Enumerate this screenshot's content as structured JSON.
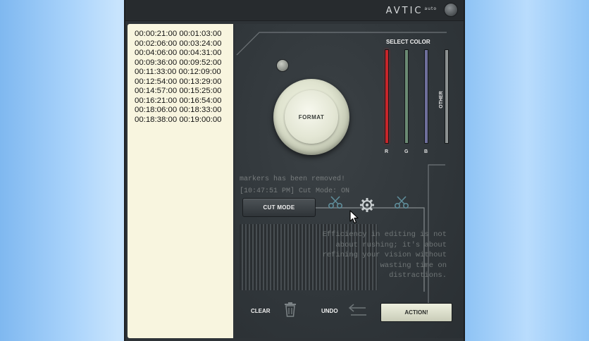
{
  "app": {
    "brand": "AVTIC",
    "brand_suffix": "auto"
  },
  "markers": [
    "00:00:21:00 00:01:03:00",
    "00:02:06:00 00:03:24:00",
    "00:04:06:00 00:04:31:00",
    "00:09:36:00 00:09:52:00",
    "00:11:33:00 00:12:09:00",
    "00:12:54:00 00:13:29:00",
    "00:14:57:00 00:15:25:00",
    "00:16:21:00 00:16:54:00",
    "00:18:06:00 00:18:33:00",
    "00:18:38:00 00:19:00:00"
  ],
  "controls": {
    "format_label": "FORMAT",
    "select_color_title": "SELECT COLOR",
    "color_labels": {
      "r": "R",
      "g": "G",
      "b": "B",
      "other": "OTHER"
    },
    "colors": {
      "r": "#c8252a",
      "g": "#6b8a73",
      "b": "#6e6f9b",
      "other": "#8c9191"
    },
    "cut_mode_label": "CUT MODE",
    "clear_label": "CLEAR",
    "undo_label": "UNDO",
    "action_label": "ACTION!"
  },
  "log": {
    "line1": "markers has been removed!",
    "line2": "[10:47:51 PM] Cut Mode: ON"
  },
  "quote": {
    "line1": "Efficiency in editing is not",
    "line2": "about rushing; it's about",
    "line3": "refining your vision without",
    "line4": "wasting time on",
    "line5": "distractions."
  },
  "icons": {
    "scissors_left": "scissors-icon",
    "gear": "gear-icon",
    "scissors_right": "scissors-icon",
    "trash": "trash-icon",
    "undo": "undo-arrow-icon",
    "cursor": "mouse-cursor"
  }
}
